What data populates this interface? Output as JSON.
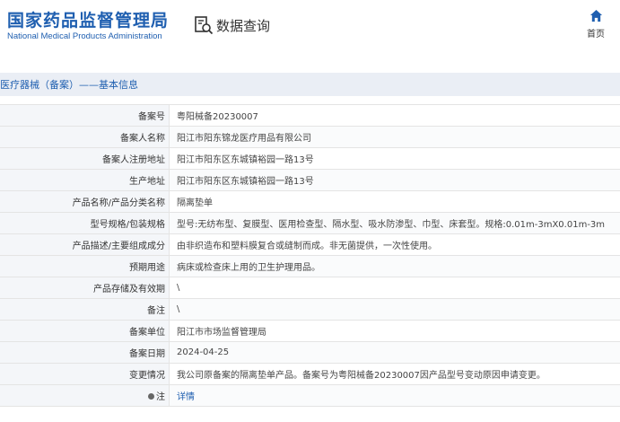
{
  "header": {
    "logo_cn": "国家药品监督管理局",
    "logo_en": "National Medical Products Administration",
    "query_label": "数据查询",
    "home_label": "首页"
  },
  "section": {
    "title": "医疗器械（备案）——基本信息"
  },
  "rows": [
    {
      "label": "备案号",
      "value": "粤阳械备20230007"
    },
    {
      "label": "备案人名称",
      "value": "阳江市阳东锦龙医疗用品有限公司"
    },
    {
      "label": "备案人注册地址",
      "value": "阳江市阳东区东城镇裕园一路13号"
    },
    {
      "label": "生产地址",
      "value": "阳江市阳东区东城镇裕园一路13号"
    },
    {
      "label": "产品名称/产品分类名称",
      "value": "隔离垫单"
    },
    {
      "label": "型号规格/包装规格",
      "value": "型号:无纺布型、复膜型、医用检查型、隔水型、吸水防渗型、巾型、床套型。规格:0.01m-3mX0.01m-3m"
    },
    {
      "label": "产品描述/主要组成成分",
      "value": "由非织造布和塑料膜复合或缝制而成。非无菌提供，一次性使用。"
    },
    {
      "label": "预期用途",
      "value": "病床或检查床上用的卫生护理用品。"
    },
    {
      "label": "产品存储及有效期",
      "value": "\\"
    },
    {
      "label": "备注",
      "value": "\\"
    },
    {
      "label": "备案单位",
      "value": "阳江市市场监督管理局"
    },
    {
      "label": "备案日期",
      "value": "2024-04-25"
    },
    {
      "label": "变更情况",
      "value": "我公司原备案的隔离垫单产品。备案号为粤阳械备20230007因产品型号变动原因申请变更。"
    },
    {
      "label": "注",
      "value": "详情"
    }
  ],
  "colors": {
    "brand_blue": "#1f5fb0",
    "section_bg": "#eaeef5",
    "label_bg": "#f4f6f9"
  }
}
